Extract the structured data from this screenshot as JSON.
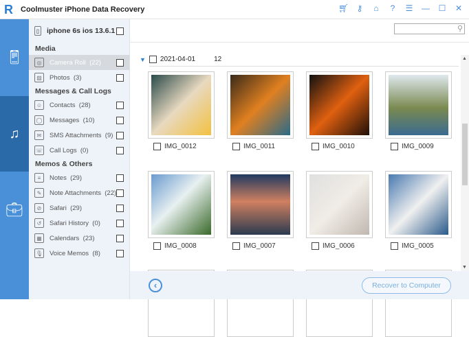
{
  "app": {
    "logo": "R",
    "title": "Coolmuster iPhone Data Recovery",
    "window_icons": [
      "cart-icon",
      "key-icon",
      "home-icon",
      "help-icon",
      "feedback-icon",
      "minimize-icon",
      "maximize-icon",
      "close-icon"
    ]
  },
  "sidebar": {
    "device": "iphone 6s ios 13.6.1",
    "sections": [
      {
        "title": "Media",
        "items": [
          {
            "label": "Camera Roll",
            "count": "(22)",
            "active": true
          },
          {
            "label": "Photos",
            "count": "(3)"
          }
        ]
      },
      {
        "title": "Messages & Call Logs",
        "items": [
          {
            "label": "Contacts",
            "count": "(28)"
          },
          {
            "label": "Messages",
            "count": "(10)"
          },
          {
            "label": "SMS Attachments",
            "count": "(9)"
          },
          {
            "label": "Call Logs",
            "count": "(0)"
          }
        ]
      },
      {
        "title": "Memos & Others",
        "items": [
          {
            "label": "Notes",
            "count": "(29)"
          },
          {
            "label": "Note Attachments",
            "count": "(22)"
          },
          {
            "label": "Safari",
            "count": "(29)"
          },
          {
            "label": "Safari History",
            "count": "(0)"
          },
          {
            "label": "Calendars",
            "count": "(23)"
          },
          {
            "label": "Voice Memos",
            "count": "(8)"
          }
        ]
      }
    ]
  },
  "main": {
    "search_placeholder": "",
    "group": {
      "date": "2021-04-01",
      "count": "12"
    },
    "images": [
      "IMG_0012",
      "IMG_0011",
      "IMG_0010",
      "IMG_0009",
      "IMG_0008",
      "IMG_0007",
      "IMG_0006",
      "IMG_0005"
    ]
  },
  "footer": {
    "recover_label": "Recover to Computer"
  }
}
